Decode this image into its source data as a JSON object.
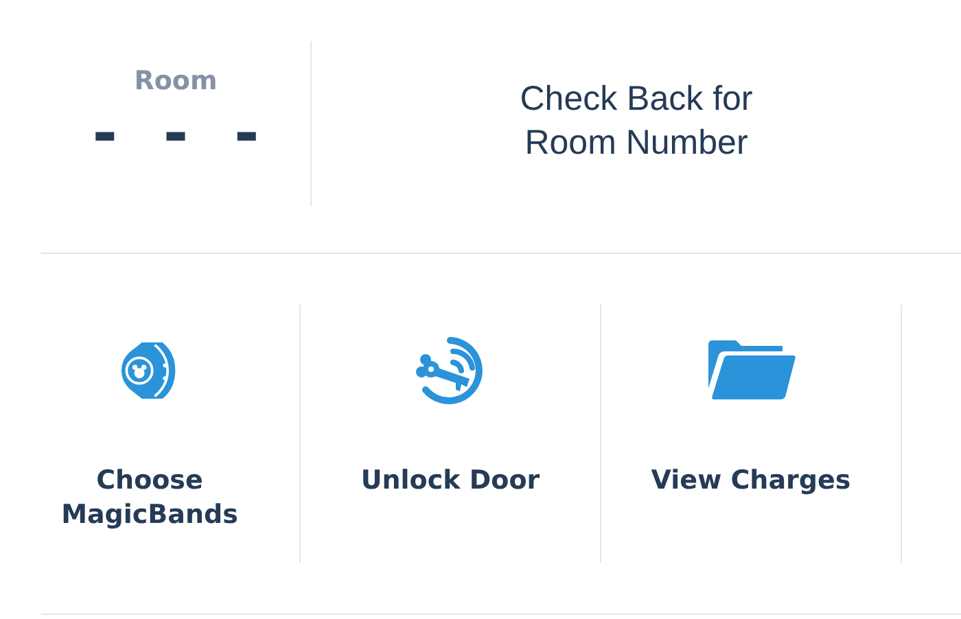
{
  "room": {
    "label": "Room",
    "number": "- - -",
    "message": "Check Back for Room Number"
  },
  "actions": [
    {
      "kind": "band",
      "label": "Choose MagicBands"
    },
    {
      "kind": "key",
      "label": "Unlock Door"
    },
    {
      "kind": "folder",
      "label": "View Charges"
    }
  ]
}
